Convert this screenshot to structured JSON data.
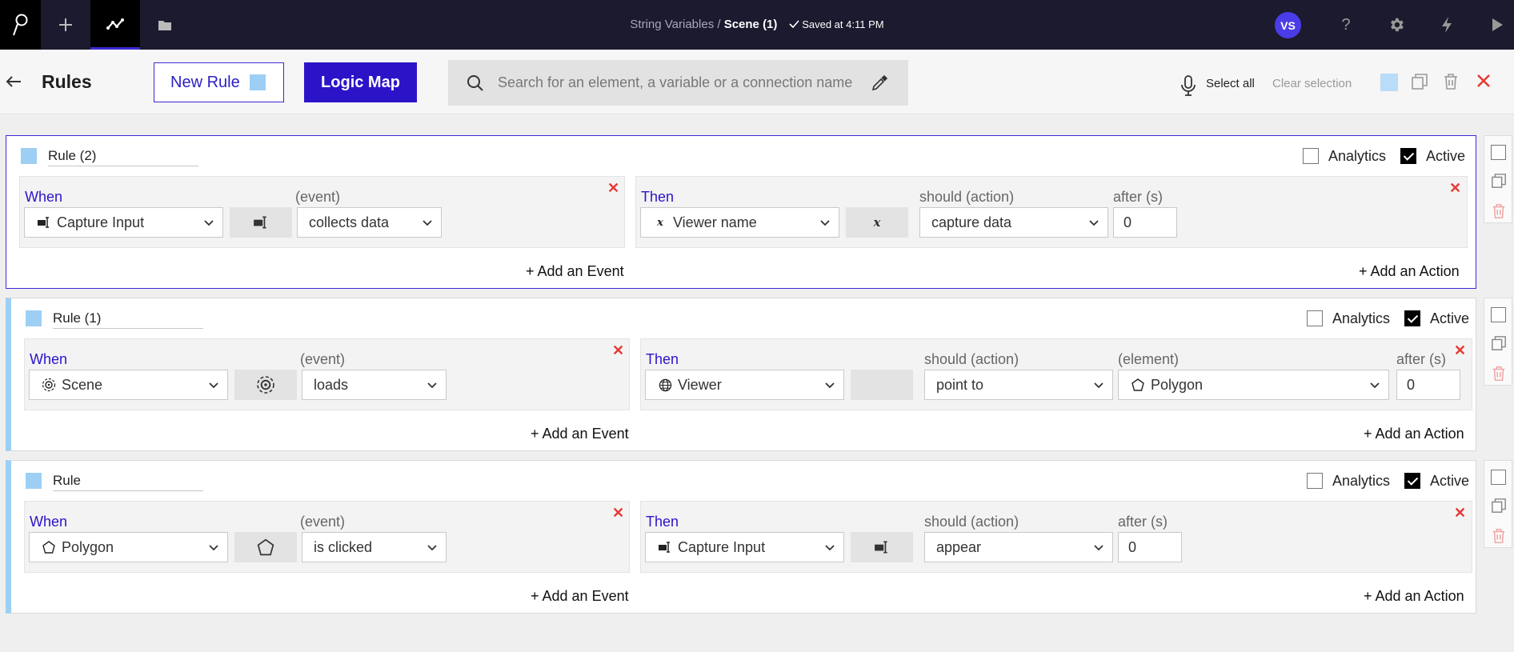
{
  "topbar": {
    "breadcrumb_parent": "String Variables /",
    "breadcrumb_current": "Scene (1)",
    "saved_text": "Saved at 4:11 PM",
    "avatar_initials": "VS"
  },
  "header": {
    "title": "Rules",
    "new_rule_label": "New Rule",
    "logic_map_label": "Logic Map",
    "search_placeholder": "Search for an element, a variable or a connection name",
    "select_all_label": "Select all",
    "clear_selection_label": "Clear selection"
  },
  "colors": {
    "accent": "#2b14c8",
    "rule_marker": "#9dcff5",
    "danger": "#e53935",
    "topbar": "#1b1a2e"
  },
  "rules": [
    {
      "name": "Rule (2)",
      "selected": true,
      "analytics_label": "Analytics",
      "analytics": false,
      "active_label": "Active",
      "active": true,
      "when": {
        "label": "When",
        "event_label": "(event)",
        "subject": "Capture Input",
        "subject_icon": "capture-input-icon",
        "event": "collects data"
      },
      "then": {
        "label": "Then",
        "action_label": "should (action)",
        "subject": "Viewer name",
        "subject_icon": "text-variable-icon",
        "action": "capture data",
        "after_label": "after (s)",
        "after": "0"
      },
      "add_event_label": "+ Add an Event",
      "add_action_label": "+ Add an Action"
    },
    {
      "name": "Rule (1)",
      "selected": false,
      "analytics_label": "Analytics",
      "analytics": false,
      "active_label": "Active",
      "active": true,
      "when": {
        "label": "When",
        "event_label": "(event)",
        "subject": "Scene",
        "subject_icon": "scene-icon",
        "event": "loads"
      },
      "then": {
        "label": "Then",
        "action_label": "should (action)",
        "subject": "Viewer",
        "subject_icon": "globe-icon",
        "action": "point to",
        "element_label": "(element)",
        "element": "Polygon",
        "element_icon": "polygon-icon",
        "after_label": "after (s)",
        "after": "0"
      },
      "add_event_label": "+ Add an Event",
      "add_action_label": "+ Add an Action"
    },
    {
      "name": "Rule",
      "selected": false,
      "analytics_label": "Analytics",
      "analytics": false,
      "active_label": "Active",
      "active": true,
      "when": {
        "label": "When",
        "event_label": "(event)",
        "subject": "Polygon",
        "subject_icon": "polygon-icon",
        "event": "is clicked"
      },
      "then": {
        "label": "Then",
        "action_label": "should (action)",
        "subject": "Capture Input",
        "subject_icon": "capture-input-icon",
        "action": "appear",
        "after_label": "after (s)",
        "after": "0"
      },
      "add_event_label": "+ Add an Event",
      "add_action_label": "+ Add an Action"
    }
  ]
}
